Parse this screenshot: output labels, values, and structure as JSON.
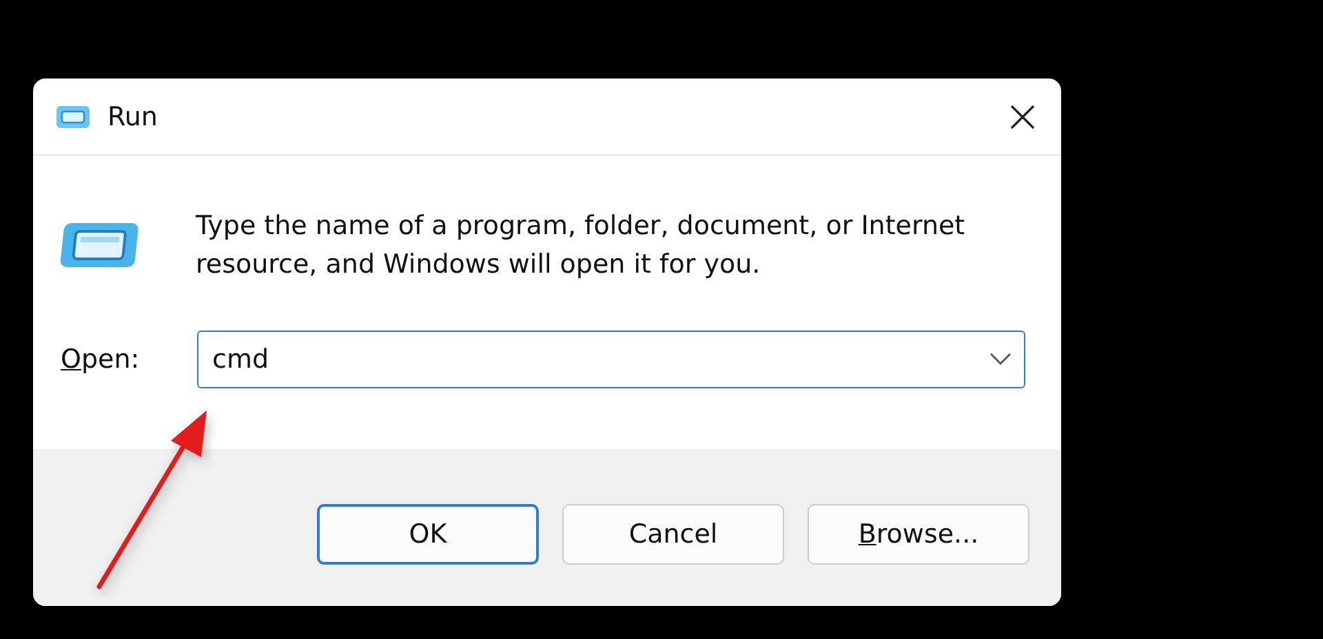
{
  "window": {
    "title": "Run"
  },
  "message": "Type the name of a program, folder, document, or Internet resource, and Windows will open it for you.",
  "open_field": {
    "label": {
      "mnemonic": "O",
      "rest": "pen:"
    },
    "value": "cmd"
  },
  "buttons": [
    {
      "rest": "OK",
      "default": true
    },
    {
      "rest": "Cancel",
      "default": false
    },
    {
      "mnemonic": "B",
      "rest": "rowse...",
      "default": false
    }
  ]
}
